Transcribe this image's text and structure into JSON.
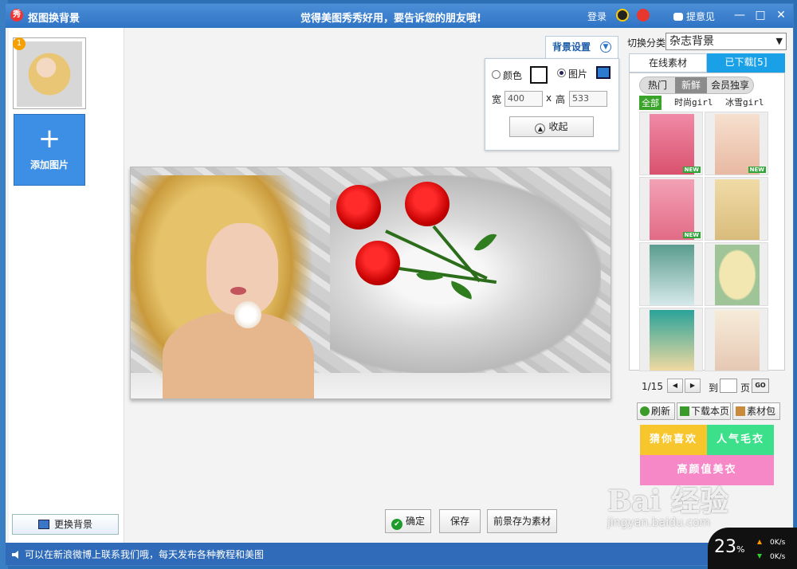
{
  "titlebar": {
    "app_title": "抠图换背景",
    "slogan": "觉得美图秀秀好用，要告诉您的朋友哦!",
    "login": "登录",
    "feedback": "提意见",
    "minimize": "—",
    "maximize": "□",
    "close": "✕"
  },
  "left": {
    "thumb_number": "1",
    "add_image": "添加图片",
    "change_background": "更换背景"
  },
  "background_settings": {
    "tab_label": "背景设置",
    "color_label": "颜色",
    "image_label": "图片",
    "selected_mode": "图片",
    "width_label": "宽",
    "width_value": "400",
    "times": "x",
    "height_label": "高",
    "height_value": "533",
    "collapse": "收起"
  },
  "actions": {
    "confirm": "确定",
    "save": "保存",
    "save_foreground": "前景存为素材"
  },
  "right": {
    "category_label": "切换分类",
    "category_value": "杂志背景",
    "tab_online": "在线素材",
    "tab_downloaded": "已下载[5]",
    "pills": [
      "热门",
      "新鲜",
      "会员独享"
    ],
    "active_pill": "新鲜",
    "filters": [
      "全部",
      "时尚girl",
      "冰雪girl"
    ],
    "active_filter": "全部",
    "new_badge": "NEW",
    "page_indicator": "1/15",
    "goto_label": "到",
    "page_unit": "页",
    "go": "GO",
    "refresh": "刷新",
    "download_page": "下载本页",
    "material_pack": "素材包",
    "promo": [
      "猜你喜欢",
      "人气毛衣",
      "高颜值美衣"
    ]
  },
  "status": {
    "message": "可以在新浪微博上联系我们哦，每天发布各种教程和美图"
  },
  "watermark": {
    "brand": "Bai 经验",
    "url": "jingyan.baidu.com"
  },
  "speed_widget": {
    "percent": "23",
    "percent_unit": "%",
    "up": "0K/s",
    "down": "0K/s"
  },
  "colors": {
    "titlebar": "#2f73c4",
    "tab_downloaded": "#1aa0e6",
    "promo_yellow": "#f6c62c",
    "promo_green": "#3ce08a",
    "promo_pink": "#f788c8"
  }
}
